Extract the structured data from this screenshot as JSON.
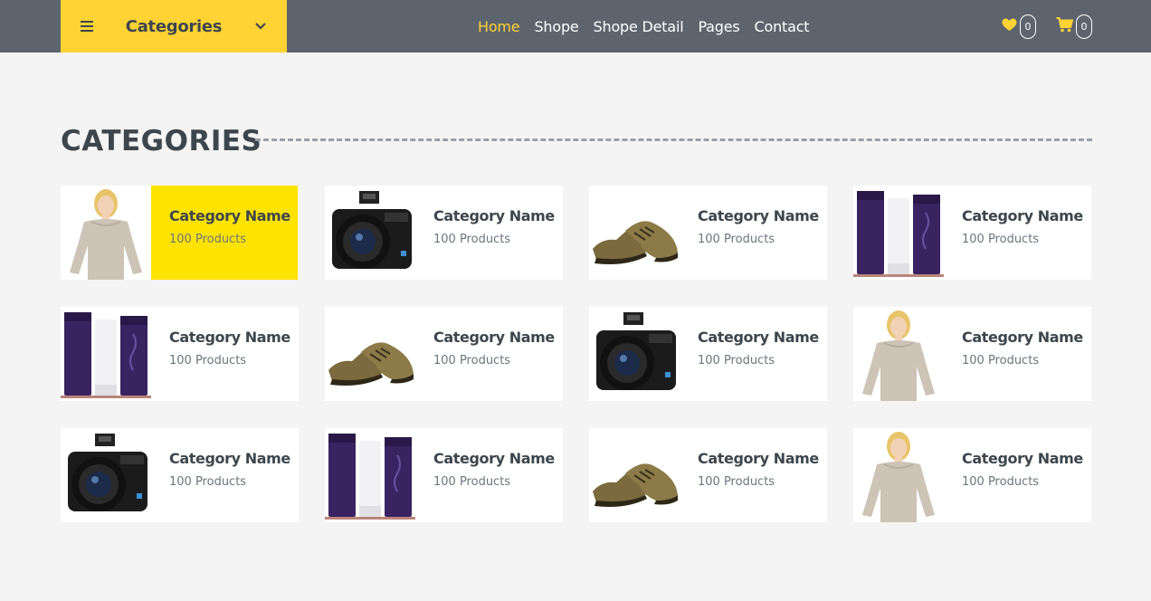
{
  "header": {
    "categories_label": "Categories",
    "nav": [
      {
        "label": "Home",
        "active": true
      },
      {
        "label": "Shope",
        "active": false
      },
      {
        "label": "Shope Detail",
        "active": false
      },
      {
        "label": "Pages",
        "active": false
      },
      {
        "label": "Contact",
        "active": false
      }
    ],
    "wishlist_count": "0",
    "cart_count": "0",
    "icons": [
      "menu-bars-icon",
      "chevron-down-icon",
      "heart-icon",
      "shopping-cart-icon"
    ]
  },
  "section": {
    "title": "CATEGORIES"
  },
  "categories": [
    {
      "name": "Category Name",
      "count": "100 Products",
      "image": "woman-sweater"
    },
    {
      "name": "Category Name",
      "count": "100 Products",
      "image": "camera"
    },
    {
      "name": "Category Name",
      "count": "100 Products",
      "image": "shoes"
    },
    {
      "name": "Category Name",
      "count": "100 Products",
      "image": "cosmetics"
    },
    {
      "name": "Category Name",
      "count": "100 Products",
      "image": "cosmetics"
    },
    {
      "name": "Category Name",
      "count": "100 Products",
      "image": "shoes"
    },
    {
      "name": "Category Name",
      "count": "100 Products",
      "image": "camera"
    },
    {
      "name": "Category Name",
      "count": "100 Products",
      "image": "woman-sweater"
    },
    {
      "name": "Category Name",
      "count": "100 Products",
      "image": "camera"
    },
    {
      "name": "Category Name",
      "count": "100 Products",
      "image": "cosmetics"
    },
    {
      "name": "Category Name",
      "count": "100 Products",
      "image": "shoes"
    },
    {
      "name": "Category Name",
      "count": "100 Products",
      "image": "woman-sweater"
    }
  ],
  "colors": {
    "accent": "#ffd333",
    "highlight": "#ffe300",
    "navbar": "#5d646e",
    "text": "#3d464d"
  }
}
